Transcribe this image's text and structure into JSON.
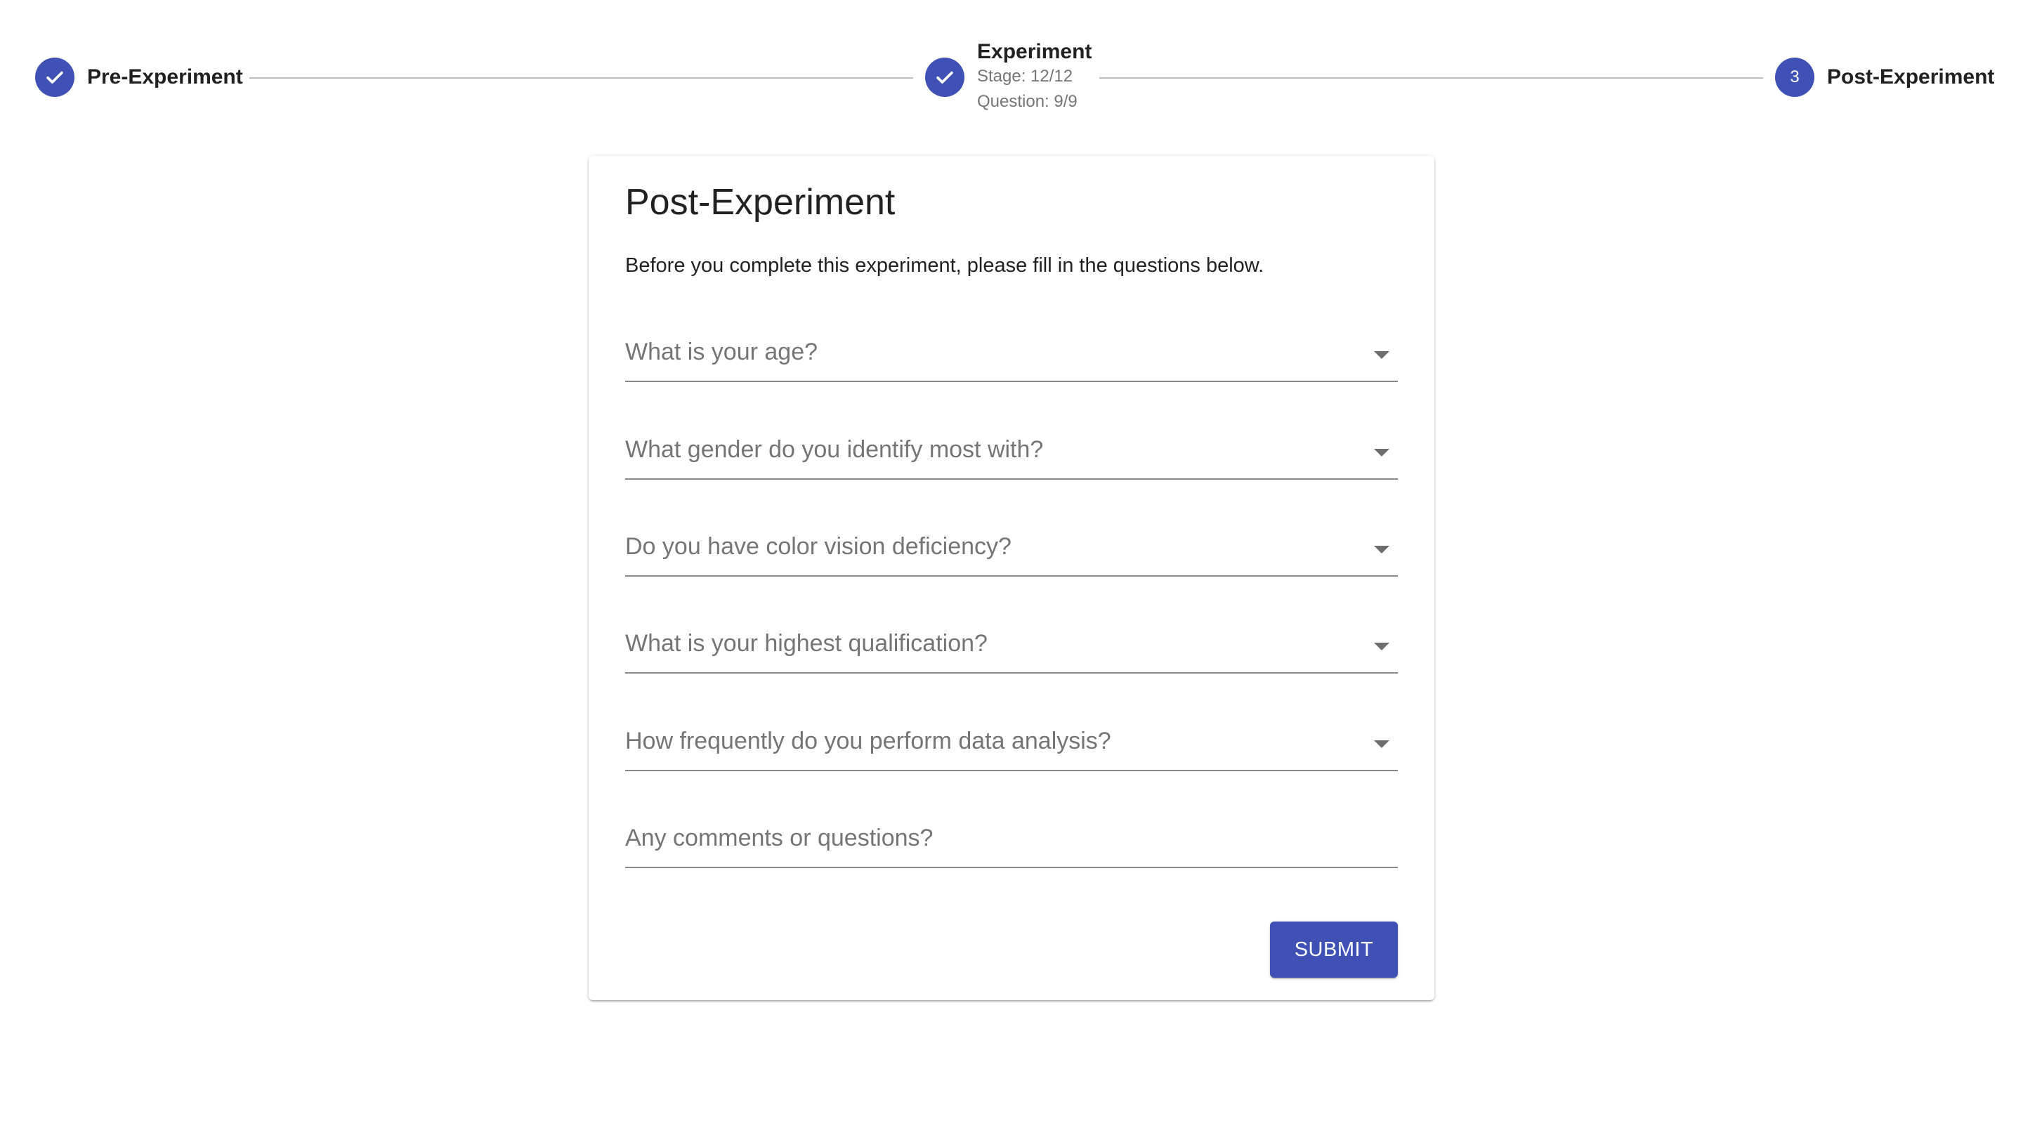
{
  "stepper": {
    "steps": [
      {
        "label": "Pre-Experiment",
        "status": "completed",
        "icon": "check-icon"
      },
      {
        "label": "Experiment",
        "status": "completed",
        "icon": "check-icon",
        "stage": "Stage: 12/12",
        "question": "Question: 9/9"
      },
      {
        "label": "Post-Experiment",
        "status": "active",
        "number": "3"
      }
    ]
  },
  "form": {
    "title": "Post-Experiment",
    "description": "Before you complete this experiment, please fill in the questions below.",
    "fields": [
      {
        "label": "What is your age?",
        "type": "select"
      },
      {
        "label": "What gender do you identify most with?",
        "type": "select"
      },
      {
        "label": "Do you have color vision deficiency?",
        "type": "select"
      },
      {
        "label": "What is your highest qualification?",
        "type": "select"
      },
      {
        "label": "How frequently do you perform data analysis?",
        "type": "select"
      },
      {
        "label": "Any comments or questions?",
        "type": "text"
      }
    ],
    "submit_label": "SUBMIT"
  },
  "colors": {
    "primary": "#3f51b5",
    "divider": "#bdbdbd",
    "label": "#757575"
  }
}
